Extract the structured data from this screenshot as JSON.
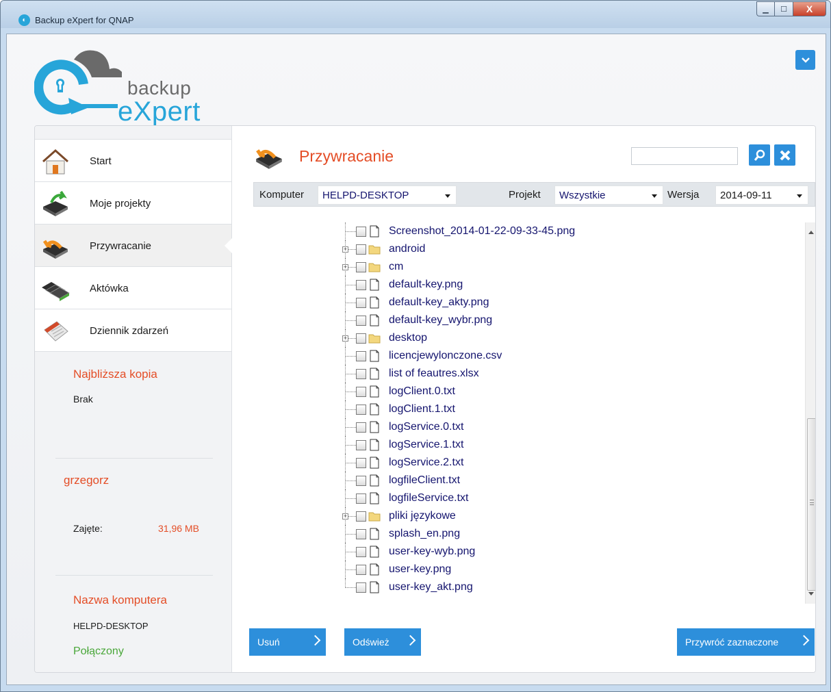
{
  "window": {
    "title": "Backup eXpert for QNAP",
    "min_symbol": "▁",
    "max_symbol": "☐",
    "close_symbol": "X"
  },
  "logo": {
    "line1": "backup",
    "line2": "eXpert"
  },
  "nav": {
    "items": [
      {
        "label": "Start",
        "icon": "home-icon"
      },
      {
        "label": "Moje projekty",
        "icon": "projects-icon"
      },
      {
        "label": "Przywracanie",
        "icon": "restore-icon",
        "active": true
      },
      {
        "label": "Aktówka",
        "icon": "briefcase-icon"
      },
      {
        "label": "Dziennik zdarzeń",
        "icon": "calendar-icon"
      }
    ]
  },
  "sidebar_info": {
    "next_copy_title": "Najbliższa kopia",
    "next_copy_value": "Brak",
    "user_name": "grzegorz",
    "used_label": "Zajęte:",
    "used_value": "31,96 MB",
    "computer_title": "Nazwa komputera",
    "computer_value": "HELPD-DESKTOP",
    "status": "Połączony"
  },
  "page": {
    "title": "Przywracanie",
    "search_placeholder": ""
  },
  "filters": {
    "computer_label": "Komputer",
    "computer_value": "HELPD-DESKTOP",
    "project_label": "Projekt",
    "project_value": "Wszystkie",
    "version_label": "Wersja",
    "version_value": "2014-09-11"
  },
  "tree": {
    "items": [
      {
        "name": "Screenshot_2014-01-22-09-33-45.png",
        "type": "file"
      },
      {
        "name": "android",
        "type": "folder"
      },
      {
        "name": "cm",
        "type": "folder"
      },
      {
        "name": "default-key.png",
        "type": "file"
      },
      {
        "name": "default-key_akty.png",
        "type": "file"
      },
      {
        "name": "default-key_wybr.png",
        "type": "file"
      },
      {
        "name": "desktop",
        "type": "folder"
      },
      {
        "name": "licencjewylonczone.csv",
        "type": "file"
      },
      {
        "name": "list of feautres.xlsx",
        "type": "file"
      },
      {
        "name": "logClient.0.txt",
        "type": "file"
      },
      {
        "name": "logClient.1.txt",
        "type": "file"
      },
      {
        "name": "logService.0.txt",
        "type": "file"
      },
      {
        "name": "logService.1.txt",
        "type": "file"
      },
      {
        "name": "logService.2.txt",
        "type": "file"
      },
      {
        "name": "logfileClient.txt",
        "type": "file"
      },
      {
        "name": "logfileService.txt",
        "type": "file"
      },
      {
        "name": "pliki językowe",
        "type": "folder"
      },
      {
        "name": "splash_en.png",
        "type": "file"
      },
      {
        "name": "user-key-wyb.png",
        "type": "file"
      },
      {
        "name": "user-key.png",
        "type": "file"
      },
      {
        "name": "user-key_akt.png",
        "type": "file"
      }
    ]
  },
  "actions": {
    "delete_label": "Usuń",
    "refresh_label": "Odśwież",
    "restore_label": "Przywróć zaznaczone"
  },
  "colors": {
    "accent": "#2d8fdb",
    "title_red": "#e44d26",
    "status_green": "#4aa73a",
    "logo_blue": "#27a5d9"
  }
}
